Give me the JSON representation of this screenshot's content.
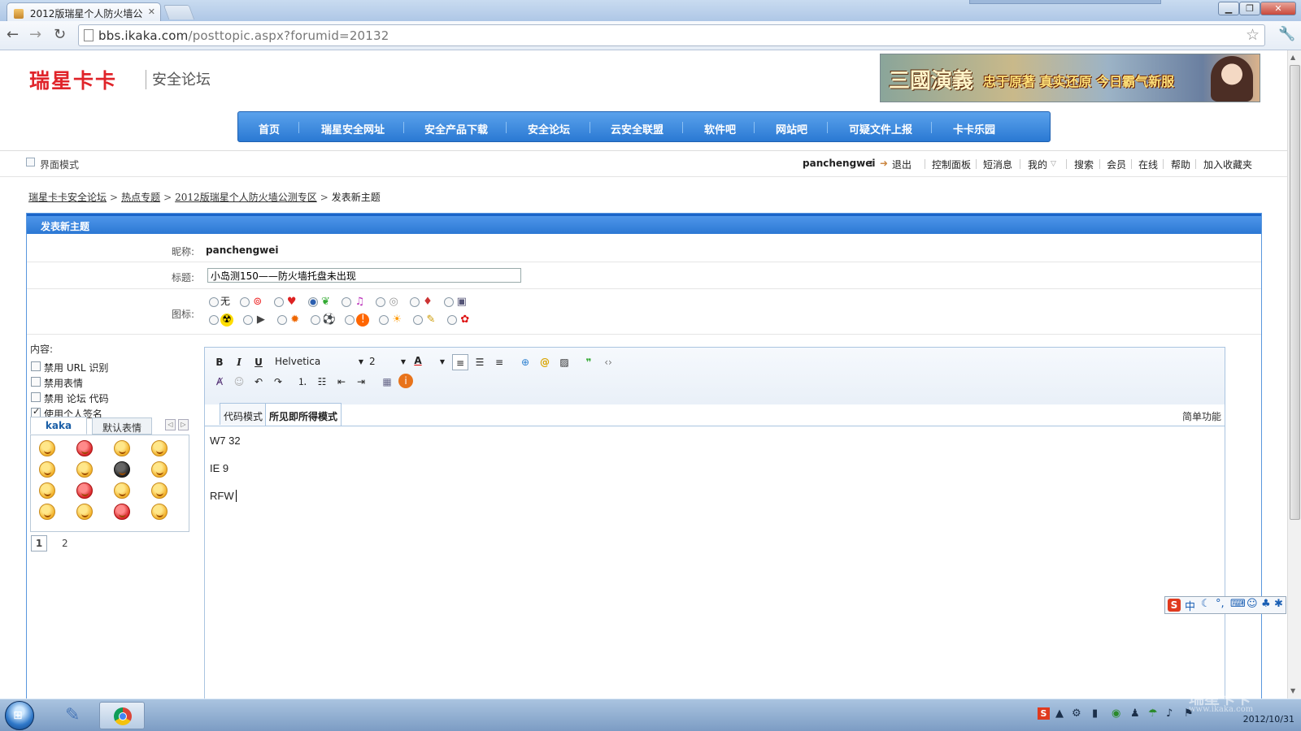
{
  "browser": {
    "tab_title": "2012版瑞星个人防火墙公",
    "url_host": "bbs.ikaka.com",
    "url_path": "/posttopic.aspx?forumid=20132"
  },
  "site": {
    "logo": "瑞星卡卡",
    "logo_sub": "安全论坛",
    "banner_title": "三國演義",
    "banner_slogan": "忠于原著 真实还原 今日霸气新服"
  },
  "nav": {
    "items": [
      "首页",
      "瑞星安全网址",
      "安全产品下载",
      "安全论坛",
      "云安全联盟",
      "软件吧",
      "网站吧",
      "可疑文件上报",
      "卡卡乐园"
    ]
  },
  "userbar": {
    "mode_label": "界面模式",
    "username": "panchengwei",
    "colon": ":",
    "logout": "退出",
    "links": [
      "控制面板",
      "短消息",
      "我的",
      "搜索",
      "会员",
      "在线",
      "帮助",
      "加入收藏夹"
    ]
  },
  "breadcrumb": {
    "items": [
      "瑞星卡卡安全论坛",
      "热点专题",
      "2012版瑞星个人防火墙公测专区"
    ],
    "current": "发表新主题",
    "separator": ">"
  },
  "form": {
    "header": "发表新主题",
    "nickname_label": "昵称:",
    "nickname": "panchengwei",
    "title_label": "标题:",
    "title_value": "小岛测150——防火墙托盘未出现",
    "icon_label": "图标:",
    "icon_none": "无",
    "content_label": "内容:",
    "options": [
      {
        "label": "禁用 URL 识别",
        "checked": false
      },
      {
        "label": "禁用表情",
        "checked": false
      },
      {
        "label": "禁用 论坛 代码",
        "checked": false
      },
      {
        "label": "使用个人签名",
        "checked": true
      }
    ],
    "smiley_tabs": [
      "kaka",
      "默认表情"
    ],
    "pages": [
      "1",
      "2"
    ]
  },
  "editor": {
    "font_name": "Helvetica",
    "font_size": "2",
    "tabs": [
      "代码模式",
      "所见即所得模式"
    ],
    "simple_label": "简单功能",
    "lines": [
      "W7 32",
      "IE 9",
      "RFW"
    ]
  },
  "taskbar": {
    "time": "2012/10/31",
    "ime": "中"
  },
  "watermark": {
    "brand": "瑞星卡卡",
    "url": "www.ikaka.com"
  }
}
